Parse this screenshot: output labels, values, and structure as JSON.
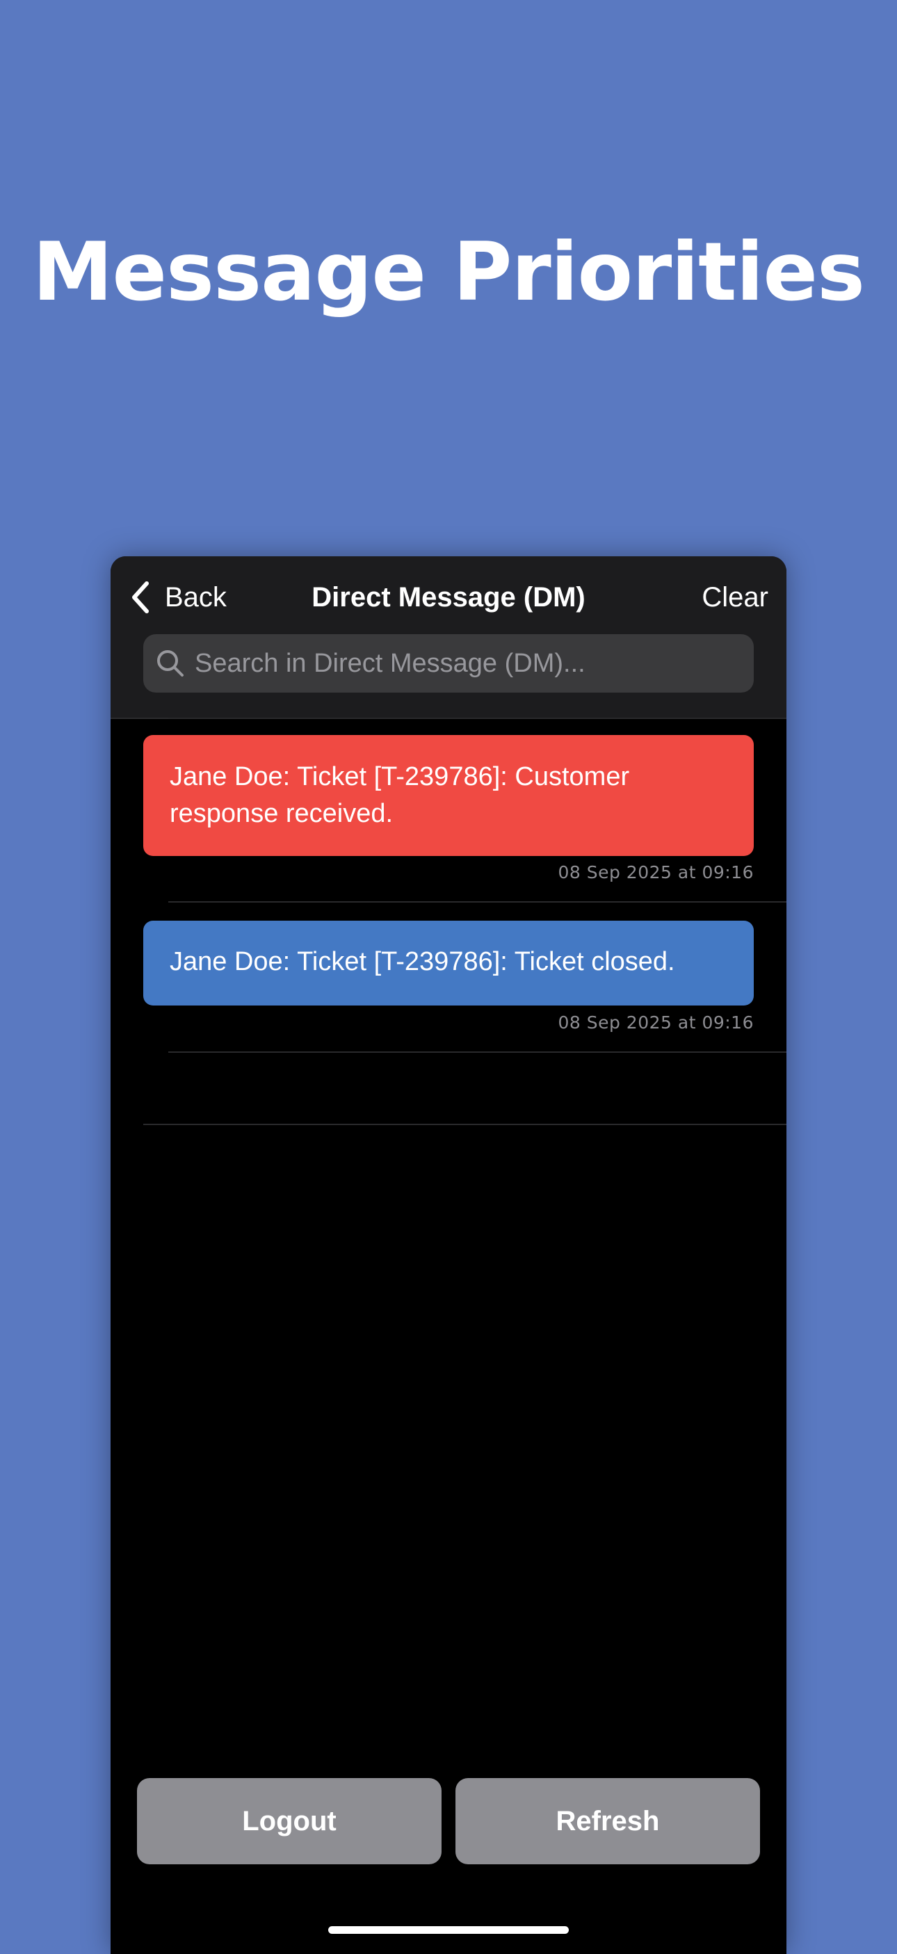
{
  "promo": {
    "headline": "Message Priorities"
  },
  "navbar": {
    "back_label": "Back",
    "title": "Direct Message (DM)",
    "clear_label": "Clear"
  },
  "search": {
    "placeholder": "Search in Direct Message (DM)..."
  },
  "messages": [
    {
      "text": "Jane Doe: Ticket [T-239786]: Customer response received.",
      "timestamp": "08 Sep 2025 at 09:16",
      "color": "#f04a43"
    },
    {
      "text": "Jane Doe: Ticket [T-239786]: Ticket closed.",
      "timestamp": "08 Sep 2025 at 09:16",
      "color": "#4479c4"
    }
  ],
  "footer": {
    "logout_label": "Logout",
    "refresh_label": "Refresh"
  },
  "colors": {
    "background": "#5a79c1",
    "button_gray": "#8e8e93"
  }
}
